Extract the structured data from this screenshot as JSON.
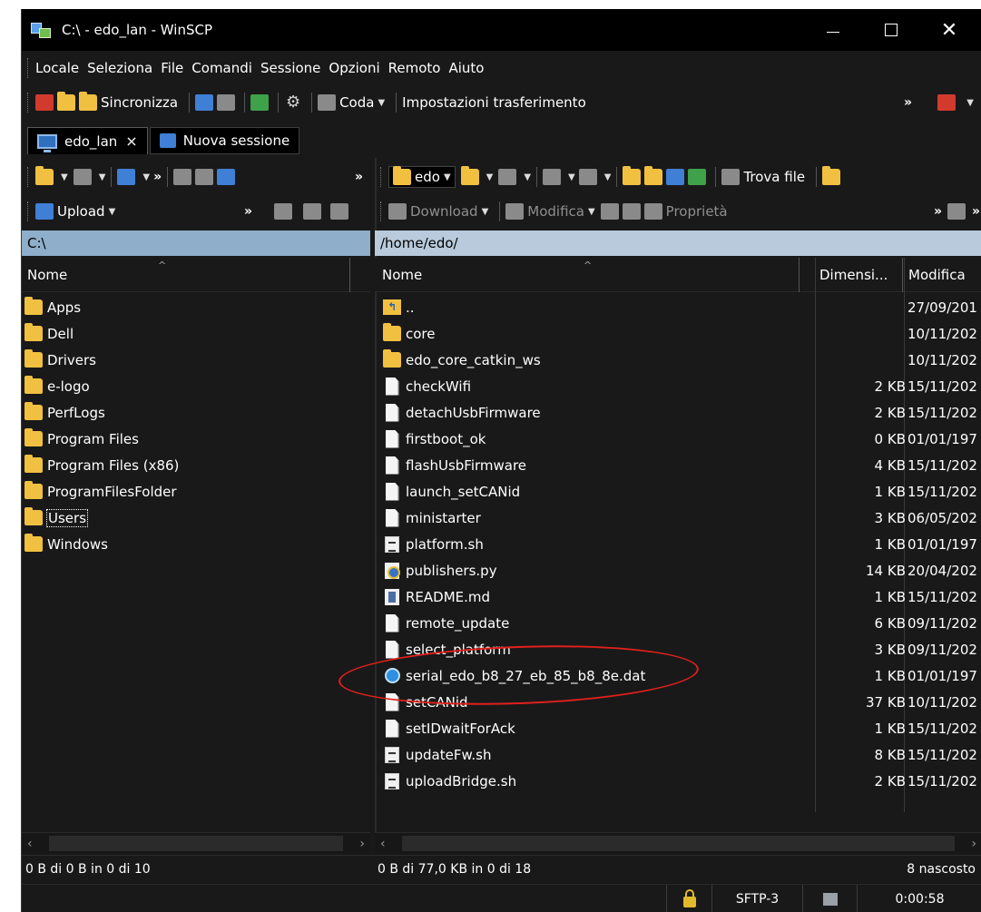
{
  "window": {
    "title": "C:\\ - edo_lan - WinSCP"
  },
  "menu": [
    "Locale",
    "Seleziona",
    "File",
    "Comandi",
    "Sessione",
    "Opzioni",
    "Remoto",
    "Aiuto"
  ],
  "toolbar": {
    "sync_label": "Sincronizza",
    "queue_label": "Coda",
    "transfer_settings_label": "Impostazioni trasferimento",
    "more": "»"
  },
  "tabs": {
    "active": "edo_lan",
    "close": "×",
    "new_session": "Nuova sessione"
  },
  "left_panel": {
    "upload_label": "Upload",
    "more": "»",
    "path": "C:\\",
    "col_name": "Nome",
    "items": [
      "Apps",
      "Dell",
      "Drivers",
      "e-logo",
      "PerfLogs",
      "Program Files",
      "Program Files (x86)",
      "ProgramFilesFolder",
      "Users",
      "Windows"
    ],
    "status": "0 B di 0 B in 0 di 10"
  },
  "right_panel": {
    "dir_label": "edo",
    "find_files_label": "Trova file",
    "download_label": "Download",
    "edit_label": "Modifica",
    "properties_label": "Proprietà",
    "more": "»",
    "path": "/home/edo/",
    "col_name": "Nome",
    "col_size": "Dimensi...",
    "col_modified": "Modifica",
    "items": [
      {
        "name": "..",
        "size": "",
        "date": "27/09/201",
        "icon": "parent-dir-icon"
      },
      {
        "name": "core",
        "size": "",
        "date": "10/11/202",
        "icon": "folder-icon"
      },
      {
        "name": "edo_core_catkin_ws",
        "size": "",
        "date": "10/11/202",
        "icon": "folder-icon"
      },
      {
        "name": "checkWifi",
        "size": "2 KB",
        "date": "15/11/202",
        "icon": "file-icon"
      },
      {
        "name": "detachUsbFirmware",
        "size": "2 KB",
        "date": "15/11/202",
        "icon": "file-icon"
      },
      {
        "name": "firstboot_ok",
        "size": "0 KB",
        "date": "01/01/197",
        "icon": "file-icon"
      },
      {
        "name": "flashUsbFirmware",
        "size": "4 KB",
        "date": "15/11/202",
        "icon": "file-icon"
      },
      {
        "name": "launch_setCANid",
        "size": "1 KB",
        "date": "15/11/202",
        "icon": "file-icon"
      },
      {
        "name": "ministarter",
        "size": "3 KB",
        "date": "06/05/202",
        "icon": "file-icon"
      },
      {
        "name": "platform.sh",
        "size": "1 KB",
        "date": "01/01/197",
        "icon": "shell-script-icon"
      },
      {
        "name": "publishers.py",
        "size": "14 KB",
        "date": "20/04/202",
        "icon": "python-file-icon"
      },
      {
        "name": "README.md",
        "size": "1 KB",
        "date": "15/11/202",
        "icon": "markdown-file-icon"
      },
      {
        "name": "remote_update",
        "size": "6 KB",
        "date": "09/11/202",
        "icon": "file-icon"
      },
      {
        "name": "select_platform",
        "size": "3 KB",
        "date": "09/11/202",
        "icon": "file-icon"
      },
      {
        "name": "serial_edo_b8_27_eb_85_b8_8e.dat",
        "size": "1 KB",
        "date": "01/01/197",
        "icon": "dat-file-icon"
      },
      {
        "name": "setCANid",
        "size": "37 KB",
        "date": "10/11/202",
        "icon": "file-icon"
      },
      {
        "name": "setIDwaitForAck",
        "size": "1 KB",
        "date": "15/11/202",
        "icon": "file-icon"
      },
      {
        "name": "updateFw.sh",
        "size": "8 KB",
        "date": "15/11/202",
        "icon": "shell-script-icon"
      },
      {
        "name": "uploadBridge.sh",
        "size": "2 KB",
        "date": "15/11/202",
        "icon": "shell-script-icon"
      }
    ],
    "status": "0 B di 77,0 KB in 0 di 18",
    "hidden": "8 nascosto"
  },
  "statusbar": {
    "protocol": "SFTP-3",
    "elapsed": "0:00:58"
  },
  "colors": {
    "background": "#191919",
    "title_bar": "#000000",
    "left_path_bar": "#8eaec9",
    "right_path_bar": "#b8cadb",
    "folder": "#f2c041",
    "highlight_ellipse": "#e0201c"
  }
}
